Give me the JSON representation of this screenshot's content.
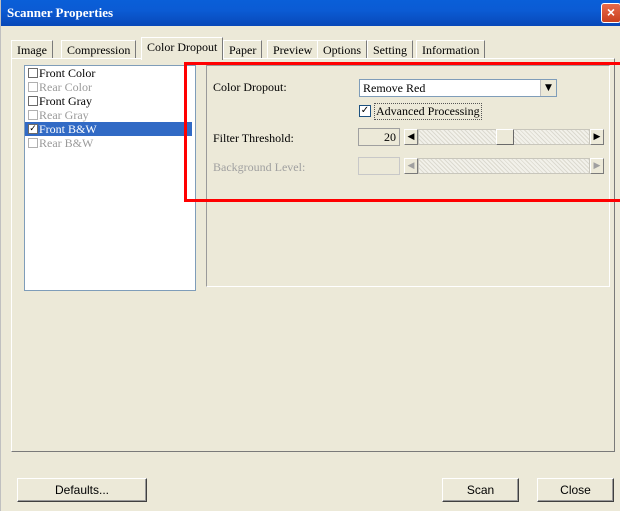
{
  "window": {
    "title": "Scanner Properties",
    "close_glyph": "×"
  },
  "tabs": [
    {
      "label": "Image"
    },
    {
      "label": "Compression"
    },
    {
      "label": "Color Dropout"
    },
    {
      "label": "Paper"
    },
    {
      "label": "Preview"
    },
    {
      "label": "Options"
    },
    {
      "label": "Setting"
    },
    {
      "label": "Information"
    }
  ],
  "active_tab": "Color Dropout",
  "image_list": [
    {
      "label": "Front Color",
      "checked": false,
      "enabled": true,
      "selected": false
    },
    {
      "label": "Rear Color",
      "checked": false,
      "enabled": false,
      "selected": false
    },
    {
      "label": "Front Gray",
      "checked": false,
      "enabled": true,
      "selected": false
    },
    {
      "label": "Rear Gray",
      "checked": false,
      "enabled": false,
      "selected": false
    },
    {
      "label": "Front B&W",
      "checked": true,
      "enabled": true,
      "selected": true
    },
    {
      "label": "Rear B&W",
      "checked": false,
      "enabled": false,
      "selected": false
    }
  ],
  "settings": {
    "color_dropout_label": "Color Dropout:",
    "color_dropout_value": "Remove Red",
    "advanced_processing_label": "Advanced Processing",
    "advanced_processing_checked": true,
    "filter_threshold_label": "Filter Threshold:",
    "filter_threshold_value": "20",
    "background_level_label": "Background Level:"
  },
  "glyphs": {
    "check": "✓",
    "dropdown": "▼",
    "arrow_left": "◀",
    "arrow_right": "▶"
  },
  "buttons": {
    "defaults": "Defaults...",
    "scan": "Scan",
    "close": "Close"
  },
  "colors": {
    "title_bar": "#0a5fd8",
    "selection": "#316ac5",
    "highlight_box": "#ff0000",
    "close_button": "#d9532f"
  }
}
